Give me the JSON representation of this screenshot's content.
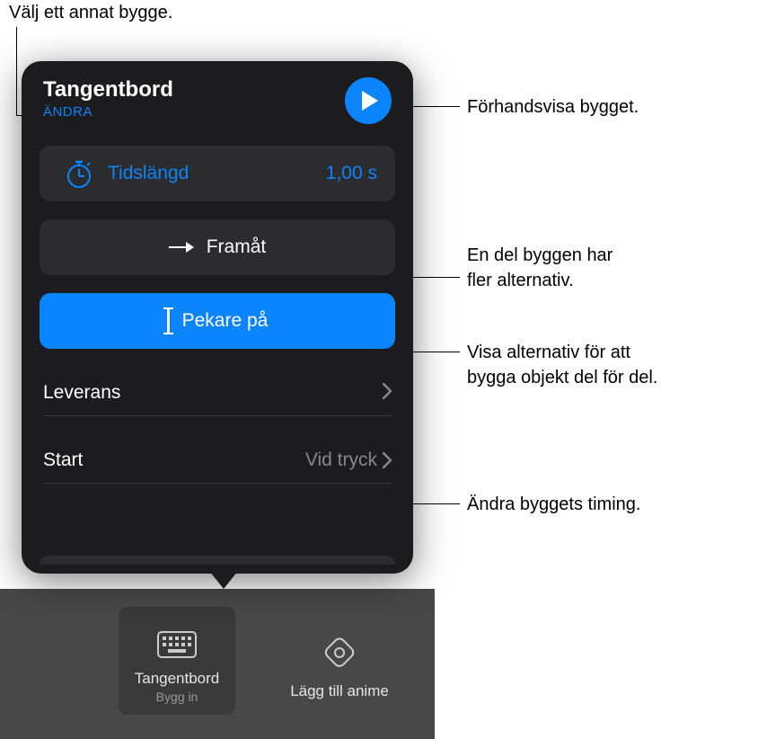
{
  "callouts": {
    "top": "Välj ett annat bygge.",
    "preview": "Förhandsvisa bygget.",
    "options_line1": "En del byggen har",
    "options_line2": "fler alternativ.",
    "delivery_line1": "Visa alternativ för att",
    "delivery_line2": "bygga objekt del för del.",
    "timing": "Ändra byggets timing."
  },
  "popover": {
    "title": "Tangentbord",
    "subtitle": "ÄNDRA",
    "duration_label": "Tidslängd",
    "duration_value": "1,00 s",
    "direction_label": "Framåt",
    "delivery_button_label": "Pekare på",
    "leverans_label": "Leverans",
    "start_label": "Start",
    "start_value": "Vid tryck"
  },
  "tabs": {
    "selected_label": "Tangentbord",
    "selected_sublabel": "Bygg in",
    "other_label": "Lägg till anime"
  }
}
